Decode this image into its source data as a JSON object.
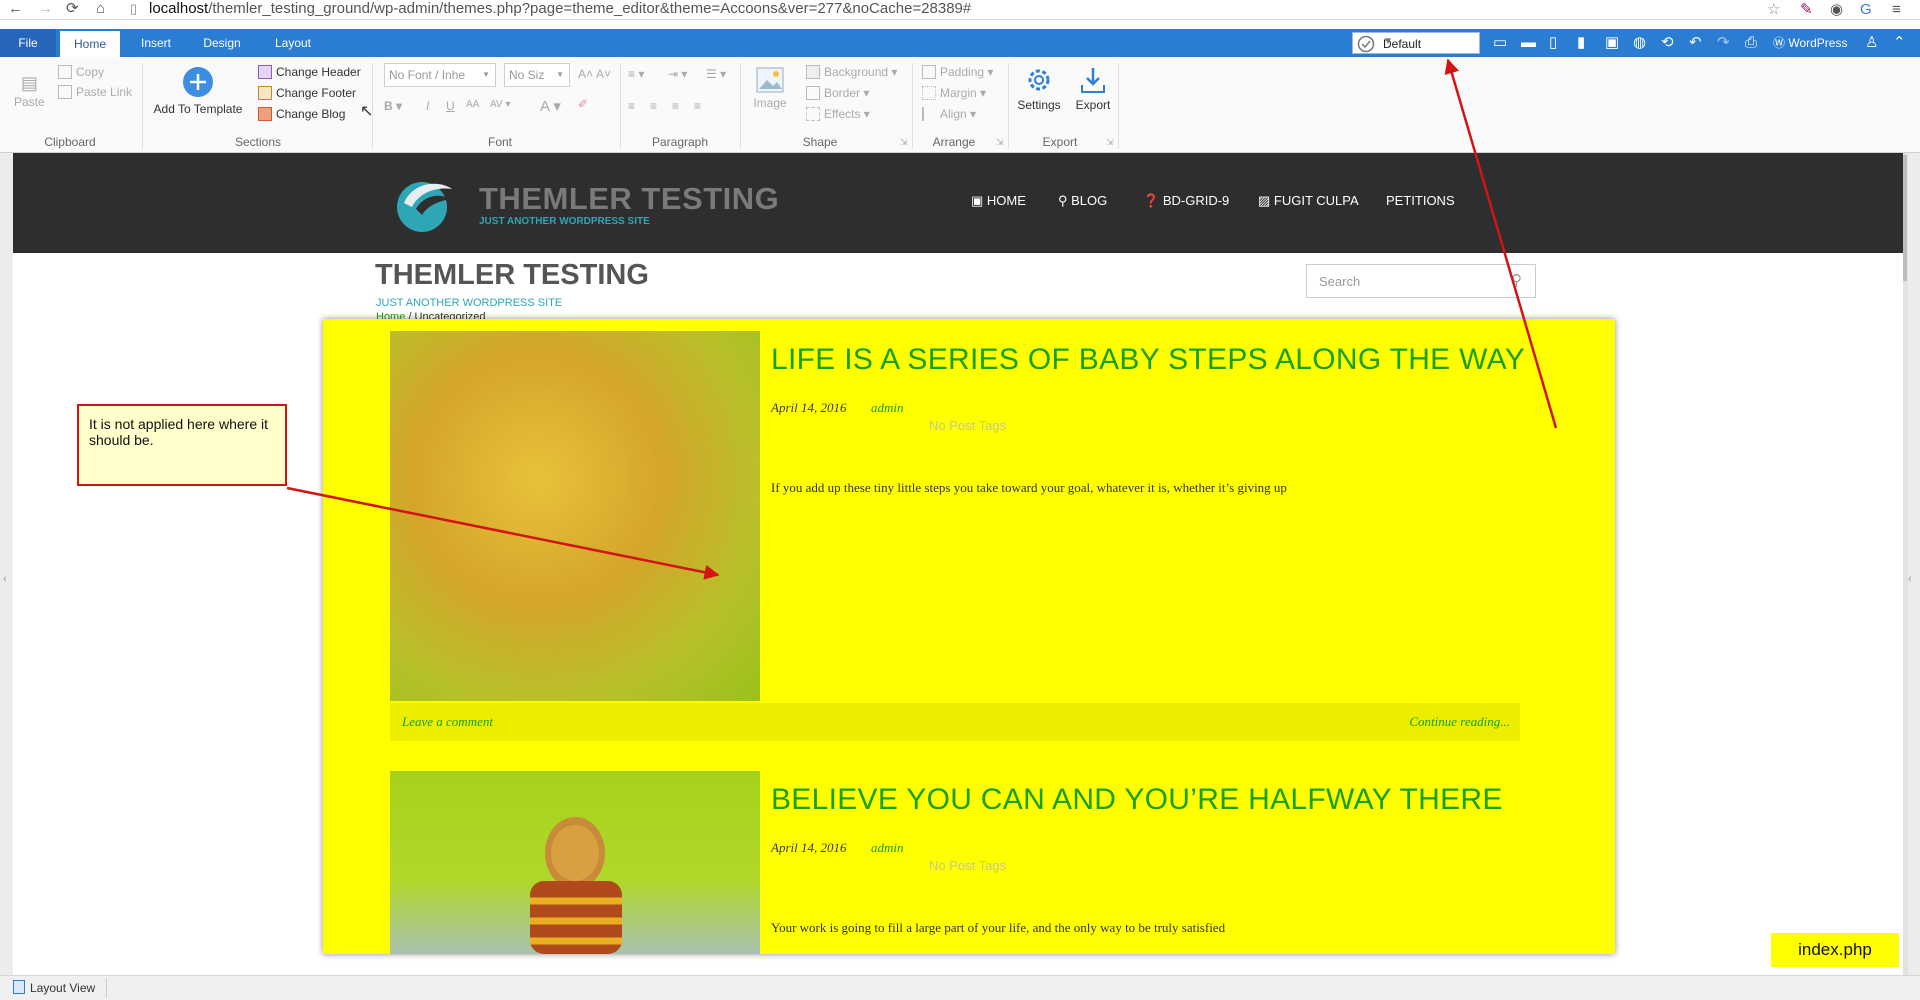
{
  "browser": {
    "url_host": "localhost",
    "url_path": "/themler_testing_ground/wp-admin/themes.php?page=theme_editor&theme=Accoons&ver=277&noCache=28389#"
  },
  "menubar": {
    "tabs": [
      "File",
      "Home",
      "Insert",
      "Design",
      "Layout"
    ],
    "active_tab": "Home",
    "preset_value": "Default",
    "wordpress_label": "WordPress"
  },
  "ribbon": {
    "clipboard": {
      "paste": "Paste",
      "copy": "Copy",
      "paste_link": "Paste Link",
      "label": "Clipboard"
    },
    "sections": {
      "add_to_template": "Add To Template",
      "change_header": "Change Header",
      "change_footer": "Change Footer",
      "change_blog": "Change Blog",
      "label": "Sections"
    },
    "font": {
      "family_placeholder": "No Font / Inhe",
      "size_placeholder": "No Siz",
      "label": "Font"
    },
    "paragraph": {
      "label": "Paragraph"
    },
    "shape": {
      "image": "Image",
      "background": "Background",
      "border": "Border",
      "effects": "Effects",
      "label": "Shape"
    },
    "arrange": {
      "padding": "Padding",
      "margin": "Margin",
      "align": "Align",
      "label": "Arrange"
    },
    "export": {
      "settings": "Settings",
      "export": "Export",
      "label": "Export"
    }
  },
  "site": {
    "logo_title": "THEMLER TESTING",
    "logo_tagline": "JUST ANOTHER WORDPRESS SITE",
    "nav": [
      "HOME",
      "BLOG",
      "BD-GRID-9",
      "FUGIT CULPA",
      "PETITIONS"
    ],
    "page_title": "THEMLER TESTING",
    "page_tagline": "JUST ANOTHER WORDPRESS SITE",
    "breadcrumb_home": "Home",
    "breadcrumb_current": "Uncategorized",
    "search_placeholder": "Search"
  },
  "posts": [
    {
      "title": "LIFE IS A SERIES OF BABY STEPS ALONG THE WAY",
      "date": "April 14, 2016",
      "author": "admin",
      "tags": "No Post Tags",
      "excerpt": "If you add up these tiny little steps you take toward your goal, whatever it is, whether it’s giving up",
      "comment_link": "Leave a comment",
      "continue_link": "Continue reading..."
    },
    {
      "title": "BELIEVE YOU CAN AND YOU’RE HALFWAY THERE",
      "date": "April 14, 2016",
      "author": "admin",
      "tags": "No Post Tags",
      "excerpt": "Your work is going to fill a large part of your life, and the only way to be truly satisfied"
    }
  ],
  "annotation": {
    "callout_text": "It is not applied here where it should be.",
    "file_badge": "index.php"
  },
  "status": {
    "layout_view": "Layout View"
  },
  "colors": {
    "menubar": "#2b7cd3",
    "highlight": "#ffff00",
    "title_green": "#18a018",
    "arrow": "#d21414"
  }
}
